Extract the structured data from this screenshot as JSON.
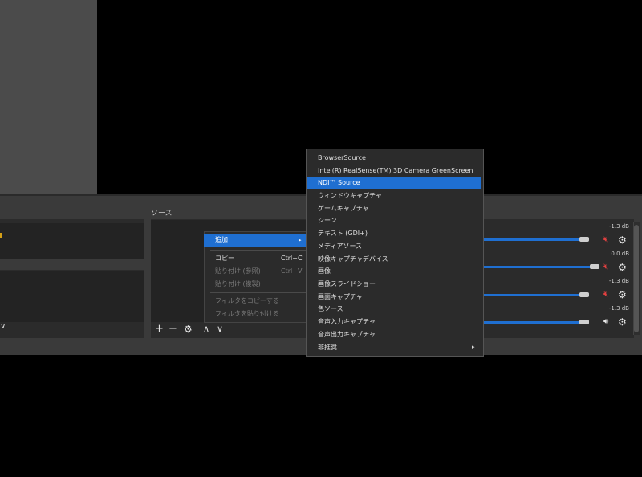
{
  "sources": {
    "title": "ソース",
    "toolbar": {
      "add": "+",
      "remove": "−",
      "settings": "⚙",
      "up": "∧",
      "down": "∨"
    }
  },
  "context_menu": {
    "items": [
      {
        "label": "追加",
        "shortcut": "",
        "highlighted": true,
        "disabled": false,
        "submenu": true
      },
      {
        "label": "コピー",
        "shortcut": "Ctrl+C",
        "highlighted": false,
        "disabled": false
      },
      {
        "label": "貼り付け (参照)",
        "shortcut": "Ctrl+V",
        "highlighted": false,
        "disabled": true
      },
      {
        "label": "貼り付け (複製)",
        "shortcut": "",
        "highlighted": false,
        "disabled": true
      },
      {
        "label": "フィルタをコピーする",
        "shortcut": "",
        "highlighted": false,
        "disabled": true
      },
      {
        "label": "フィルタを貼り付ける",
        "shortcut": "",
        "highlighted": false,
        "disabled": true
      }
    ]
  },
  "add_submenu": {
    "items": [
      {
        "label": "BrowserSource",
        "selected": false
      },
      {
        "label": "Intel(R) RealSense(TM) 3D Camera GreenScreen",
        "selected": false
      },
      {
        "label": "NDI™ Source",
        "selected": true
      },
      {
        "label": "ウィンドウキャプチャ",
        "selected": false
      },
      {
        "label": "ゲームキャプチャ",
        "selected": false
      },
      {
        "label": "シーン",
        "selected": false
      },
      {
        "label": "テキスト (GDI+)",
        "selected": false
      },
      {
        "label": "メディアソース",
        "selected": false
      },
      {
        "label": "映像キャプチャデバイス",
        "selected": false
      },
      {
        "label": "画像",
        "selected": false
      },
      {
        "label": "画像スライドショー",
        "selected": false
      },
      {
        "label": "画面キャプチャ",
        "selected": false
      },
      {
        "label": "色ソース",
        "selected": false
      },
      {
        "label": "音声入力キャプチャ",
        "selected": false
      },
      {
        "label": "音声出力キャプチャ",
        "selected": false
      },
      {
        "label": "非推奨",
        "selected": false,
        "submenu": true
      }
    ]
  },
  "mixer": {
    "channels": [
      {
        "db": "-1.3 dB",
        "muted": true,
        "level": 0.92
      },
      {
        "db": "0.0 dB",
        "muted": true,
        "level": 1.0
      },
      {
        "db": "-1.3 dB",
        "muted": true,
        "level": 0.92
      },
      {
        "db": "-1.3 dB",
        "muted": false,
        "level": 0.92
      }
    ]
  },
  "colors": {
    "accent": "#1f6fd1",
    "muted_red": "#e04040",
    "scene_marker": "#d4a017"
  }
}
